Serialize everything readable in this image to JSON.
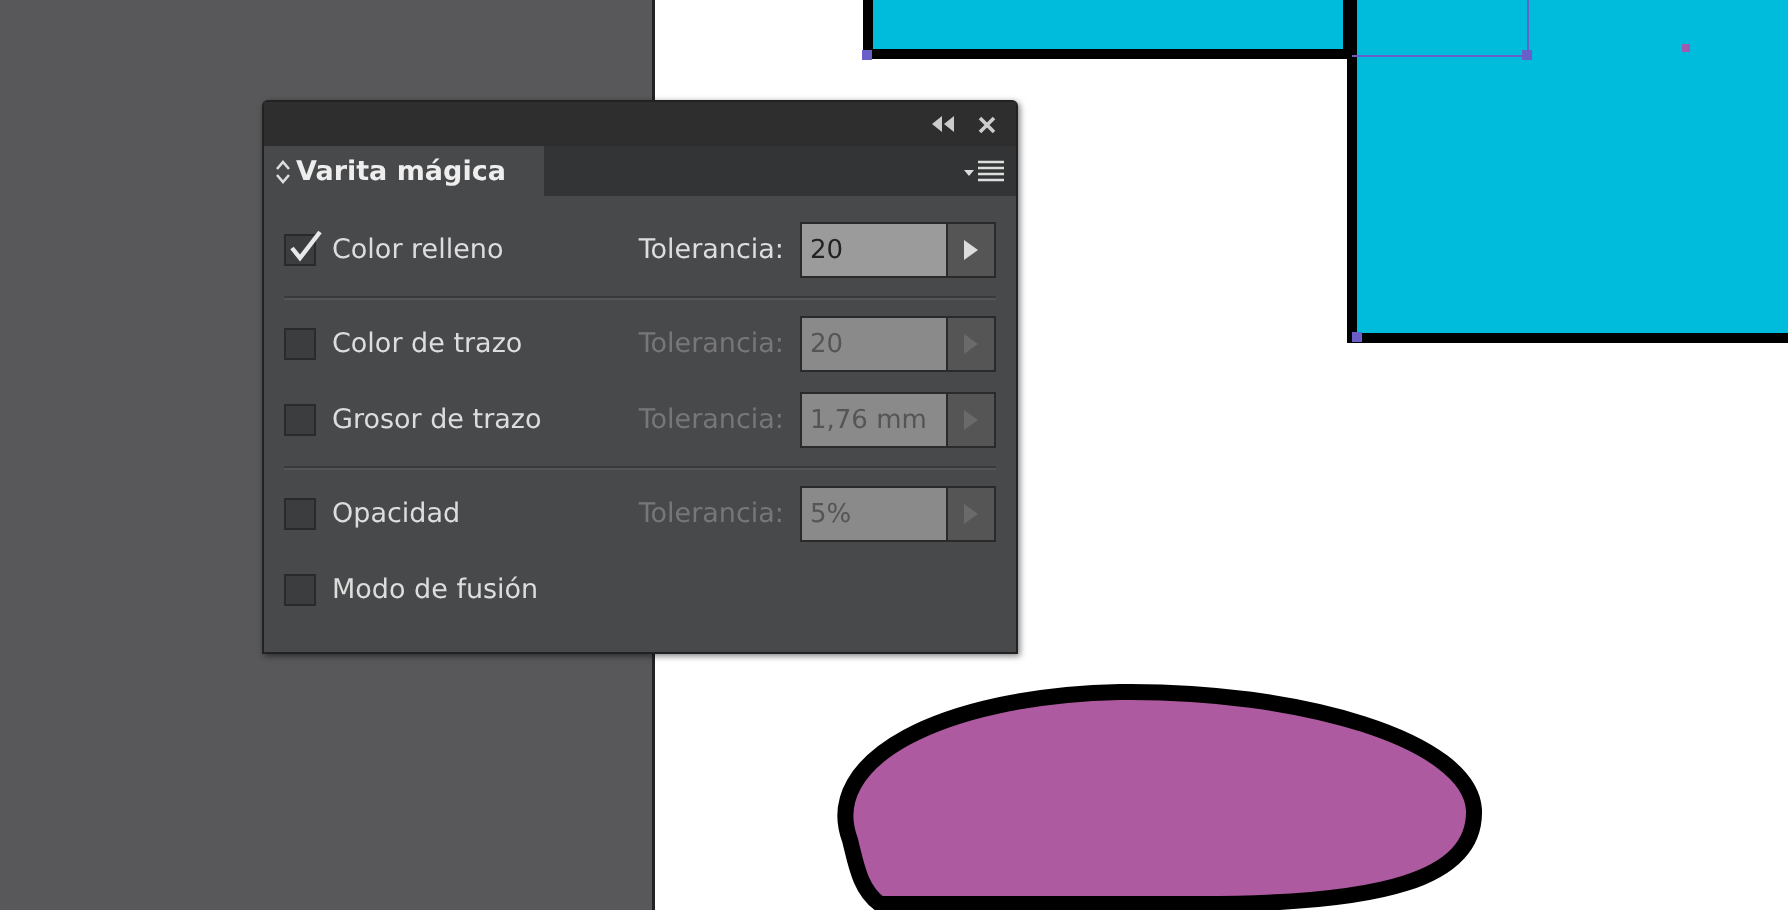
{
  "panel": {
    "title": "Varita mágica",
    "groups": [
      [
        {
          "label": "Color relleno",
          "checked": true,
          "tolerance_label": "Tolerancia:",
          "tolerance": "20",
          "disabled": false
        }
      ],
      [
        {
          "label": "Color de trazo",
          "checked": false,
          "tolerance_label": "Tolerancia:",
          "tolerance": "20",
          "disabled": true
        },
        {
          "label": "Grosor de trazo",
          "checked": false,
          "tolerance_label": "Tolerancia:",
          "tolerance": "1,76 mm",
          "disabled": true
        }
      ],
      [
        {
          "label": "Opacidad",
          "checked": false,
          "tolerance_label": "Tolerancia:",
          "tolerance": "5%",
          "disabled": true
        },
        {
          "label": "Modo de fusión",
          "checked": false
        }
      ]
    ]
  }
}
